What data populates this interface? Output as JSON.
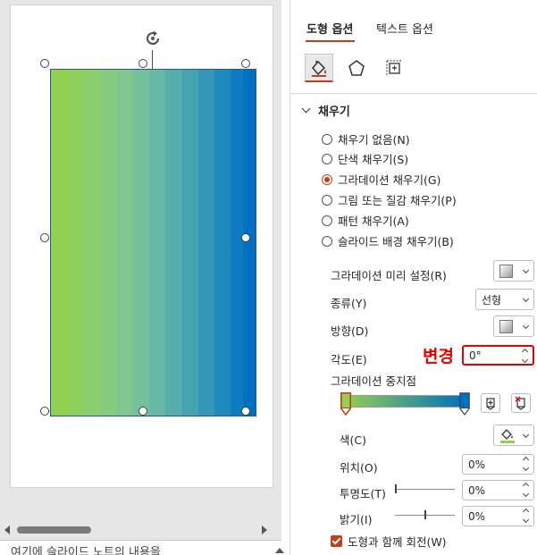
{
  "slide": {
    "notes_placeholder": "여기에 슬라이드 노트의 내용을"
  },
  "panel": {
    "tabs": [
      {
        "label": "도형 옵션",
        "active": true
      },
      {
        "label": "텍스트 옵션",
        "active": false
      }
    ],
    "categories": [
      "fill-line-icon",
      "effects-pentagon-icon",
      "size-properties-icon"
    ],
    "fill_section": {
      "title": "채우기",
      "options": [
        {
          "label": "채우기 없음(N)",
          "checked": false
        },
        {
          "label": "단색 채우기(S)",
          "checked": false
        },
        {
          "label": "그라데이션 채우기(G)",
          "checked": true
        },
        {
          "label": "그림 또는 질감 채우기(P)",
          "checked": false
        },
        {
          "label": "패턴 채우기(A)",
          "checked": false
        },
        {
          "label": "슬라이드 배경 채우기(B)",
          "checked": false
        }
      ],
      "preset_label": "그라데이션 미리 설정(R)",
      "type_label": "종류(Y)",
      "type_value": "선형",
      "direction_label": "방향(D)",
      "angle_label": "각도(E)",
      "angle_value": "0°",
      "annotation": "변경",
      "stops_label": "그라데이션 중지점",
      "color_label": "색(C)",
      "position_label": "위치(O)",
      "position_value": "0%",
      "transparency_label": "투명도(T)",
      "transparency_value": "0%",
      "brightness_label": "밝기(I)",
      "brightness_value": "0%",
      "rotate_with_shape_label": "도형과 함께 회전(W)",
      "rotate_with_shape_checked": true
    },
    "colors": {
      "accent": "#c43e1c",
      "highlight": "#e60000",
      "gradient_start": "#92d050",
      "gradient_end": "#0070c0"
    }
  }
}
